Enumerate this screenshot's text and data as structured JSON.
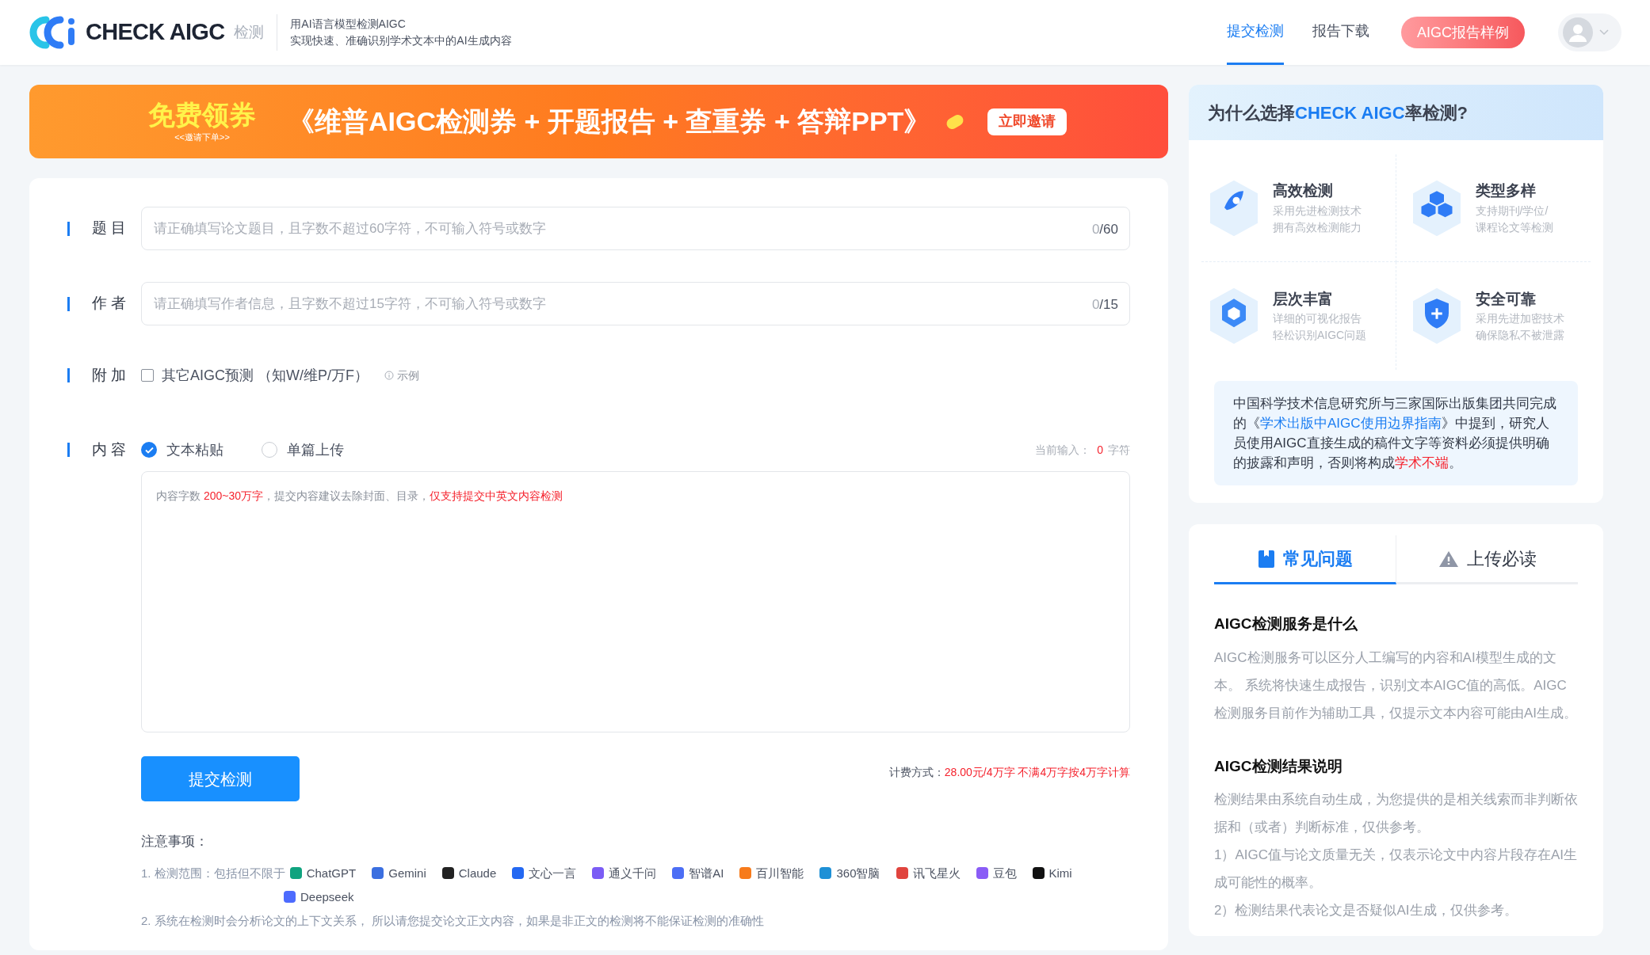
{
  "header": {
    "logo_text": "CHECK AIGC",
    "logo_sub": "检测",
    "tagline": [
      "用AI语言模型检测AIGC",
      "实现快速、准确识别学术文本中的AI生成内容"
    ],
    "nav": [
      {
        "label": "提交检测",
        "selected": true
      },
      {
        "label": "报告下载",
        "selected": false
      }
    ],
    "sample_button": "AIGC报告样例"
  },
  "banner": {
    "badge": "免费领券",
    "badge_sub": "<<邀请下单>>",
    "headline": "《维普AIGC检测券 + 开题报告 + 查重券 + 答辩PPT》",
    "button": "立即邀请"
  },
  "form": {
    "fields": [
      {
        "label": "题 目",
        "placeholder": "请正确填写论文题目，且字数不超过60字符，不可输入符号或数字",
        "count": "0",
        "limit": "/60"
      },
      {
        "label": "作 者",
        "placeholder": "请正确填写作者信息，且字数不超过15字符，不可输入符号或数字",
        "count": "0",
        "limit": "/15"
      }
    ],
    "extra": {
      "label": "附 加",
      "option": "其它AIGC预测 （知W/维P/万F）",
      "checked": false,
      "hint": "示例"
    },
    "content": {
      "label": "内 容",
      "options": [
        {
          "label": "文本粘贴",
          "selected": true
        },
        {
          "label": "单篇上传",
          "selected": false
        }
      ],
      "counter_label": "当前输入：",
      "counter_value": "0",
      "counter_unit": "字符",
      "placeholder": [
        {
          "text": "内容字数 ",
          "kind": "plain"
        },
        {
          "text": "200~30万字",
          "kind": "alert"
        },
        {
          "text": "，提交内容建议去除封面、目录，",
          "kind": "plain"
        },
        {
          "text": "仅支持提交中英文内容检测",
          "kind": "alert"
        }
      ]
    },
    "submit": "提交检测",
    "pricing_label": "计费方式：",
    "pricing_value": "28.00元/4万字 不满4万字按4万字计算",
    "notes_title": "注意事项：",
    "notes": {
      "scope_label": "1. 检测范围：包括但不限于",
      "models": [
        {
          "name": "ChatGPT",
          "color": "#10a37f"
        },
        {
          "name": "Gemini",
          "color": "#3b6fe0"
        },
        {
          "name": "Claude",
          "color": "#222222"
        },
        {
          "name": "文心一言",
          "color": "#2468f2"
        },
        {
          "name": "通义千问",
          "color": "#7b5cf5"
        },
        {
          "name": "智谱AI",
          "color": "#4c6ef5"
        },
        {
          "name": "百川智能",
          "color": "#f77b1b"
        },
        {
          "name": "360智脑",
          "color": "#1e90d6"
        },
        {
          "name": "讯飞星火",
          "color": "#e0443e"
        },
        {
          "name": "豆包",
          "color": "#8a5cf6"
        },
        {
          "name": "Kimi",
          "color": "#111111"
        },
        {
          "name": "Deepseek",
          "color": "#4d6bfe"
        }
      ],
      "second": "2. 系统在检测时会分析论文的上下文关系， 所以请您提交论文正文内容，如果是非正文的检测将不能保证检测的准确性"
    }
  },
  "why": {
    "title": [
      {
        "text": "为什么选择",
        "kind": "plain"
      },
      {
        "text": "CHECK AIGC",
        "kind": "link"
      },
      {
        "text": "率检测?",
        "kind": "plain"
      }
    ],
    "features": [
      {
        "title": "高效检测",
        "lines": [
          "采用先进检测技术",
          "拥有高效检测能力"
        ]
      },
      {
        "title": "类型多样",
        "lines": [
          "支持期刊/学位/",
          "课程论文等检测"
        ]
      },
      {
        "title": "层次丰富",
        "lines": [
          "详细的可视化报告",
          "轻松识别AIGC问题"
        ]
      },
      {
        "title": "安全可靠",
        "lines": [
          "采用先进加密技术",
          "确保隐私不被泄露"
        ]
      }
    ],
    "quote": [
      {
        "text": "中国科学技术信息研究所与三家国际出版集团共同完成的《",
        "kind": "plain"
      },
      {
        "text": "学术出版中AIGC使用边界指南",
        "kind": "link"
      },
      {
        "text": "》中提到，研究人员使用AIGC直接生成的稿件文字等资料必须提供明确的披露和声明，否则将构成",
        "kind": "plain"
      },
      {
        "text": "学术不端",
        "kind": "alert"
      },
      {
        "text": "。",
        "kind": "plain"
      }
    ]
  },
  "faq": {
    "tabs": [
      {
        "label": "常见问题",
        "selected": true
      },
      {
        "label": "上传必读",
        "selected": false
      }
    ],
    "sections": [
      {
        "heading": "AIGC检测服务是什么",
        "paragraphs": [
          "AIGC检测服务可以区分人工编写的内容和AI模型生成的文本。 系统将快速生成报告，识别文本AIGC值的高低。AIGC检测服务目前作为辅助工具，仅提示文本内容可能由AI生成。"
        ]
      },
      {
        "heading": "AIGC检测结果说明",
        "paragraphs": [
          "检测结果由系统自动生成，为您提供的是相关线索而非判断依据和（或者）判断标准，仅供参考。",
          "1）AIGC值与论文质量无关，仅表示论文中内容片段存在AI生成可能性的概率。",
          "2）检测结果代表论文是否疑似AI生成，仅供参考。"
        ]
      }
    ]
  }
}
